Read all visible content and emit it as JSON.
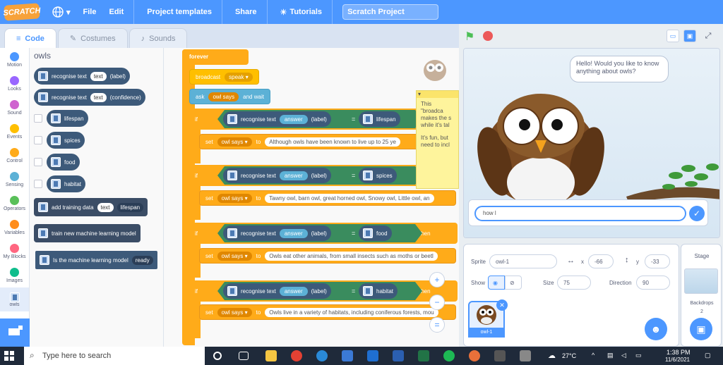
{
  "menubar": {
    "logo": "SCRATCH",
    "globe_icon": "globe-icon",
    "items": [
      "File",
      "Edit",
      "Project templates",
      "Share",
      "Tutorials"
    ],
    "project_title": "Scratch Project"
  },
  "tabs": [
    "Code",
    "Costumes",
    "Sounds"
  ],
  "categories": [
    {
      "label": "Motion",
      "color": "#4c97ff"
    },
    {
      "label": "Looks",
      "color": "#9966ff"
    },
    {
      "label": "Sound",
      "color": "#cf63cf"
    },
    {
      "label": "Events",
      "color": "#ffbf00"
    },
    {
      "label": "Control",
      "color": "#ffab19"
    },
    {
      "label": "Sensing",
      "color": "#5cb1d6"
    },
    {
      "label": "Operators",
      "color": "#59c059"
    },
    {
      "label": "Variables",
      "color": "#ff8c1a"
    },
    {
      "label": "My Blocks",
      "color": "#ff6680"
    },
    {
      "label": "Images",
      "color": "#0fbd8c"
    },
    {
      "label": "owls",
      "color": "#3d5a7a"
    }
  ],
  "palette": {
    "title": "owls",
    "recog_label": "recognise text",
    "recog_label_arg": "text",
    "recog_label_out": "(label)",
    "recog_conf_arg": "text",
    "recog_conf_out": "(confidence)",
    "labels": [
      "lifespan",
      "spices",
      "food",
      "habitat"
    ],
    "add_training": "add training data",
    "add_training_arg": "text",
    "add_training_dd": "lifespan",
    "train": "train new machine learning model",
    "is_model": "Is the machine learning model",
    "is_model_dd": "ready"
  },
  "script": {
    "forever": "forever",
    "broadcast": "broadcast",
    "broadcast_dd": "speak",
    "ask": "ask",
    "ask_var": "owl says",
    "ask_wait": "and wait",
    "if_label": "if",
    "then_label": "then",
    "recognise": "recognise text",
    "answer": "answer",
    "label_out": "(label)",
    "eq": "=",
    "set": "set",
    "set_var": "owl says",
    "to": "to",
    "rows": [
      {
        "label": "lifespan",
        "value": "Although owls have been known to live up to 25 ye"
      },
      {
        "label": "spices",
        "value": "Tawny owl, barn owl, great horned owl, Snowy owl, Little owl, an"
      },
      {
        "label": "food",
        "value": "Owls eat other animals, from small insects such as moths or beetl"
      },
      {
        "label": "habitat",
        "value": "Owls live in a variety of habitats, including coniferous forests, mou"
      }
    ],
    "note_lines": [
      "This \"broadca",
      "makes the s",
      "while it's tal",
      "",
      "It's fun, but",
      "need to incl"
    ]
  },
  "stage": {
    "speech": "Hello! Would you like to know anything about owls?",
    "answer_input": "how l",
    "sprite_label": "Sprite",
    "sprite_name": "owl-1",
    "x_label": "x",
    "x_value": "-66",
    "y_label": "y",
    "y_value": "-33",
    "show_label": "Show",
    "size_label": "Size",
    "size_value": "75",
    "direction_label": "Direction",
    "direction_value": "90",
    "thumb_name": "owl-1",
    "stage_label": "Stage",
    "backdrops_label": "Backdrops",
    "backdrops_count": "2"
  },
  "taskbar": {
    "search_placeholder": "Type here to search",
    "weather": "27°C",
    "time": "1:38 PM",
    "date": "11/6/2021"
  },
  "colors": {
    "accent": "#4c97ff",
    "control": "#ffab19",
    "ml_block": "#3d5a7a",
    "operator": "#3a8c5e"
  }
}
